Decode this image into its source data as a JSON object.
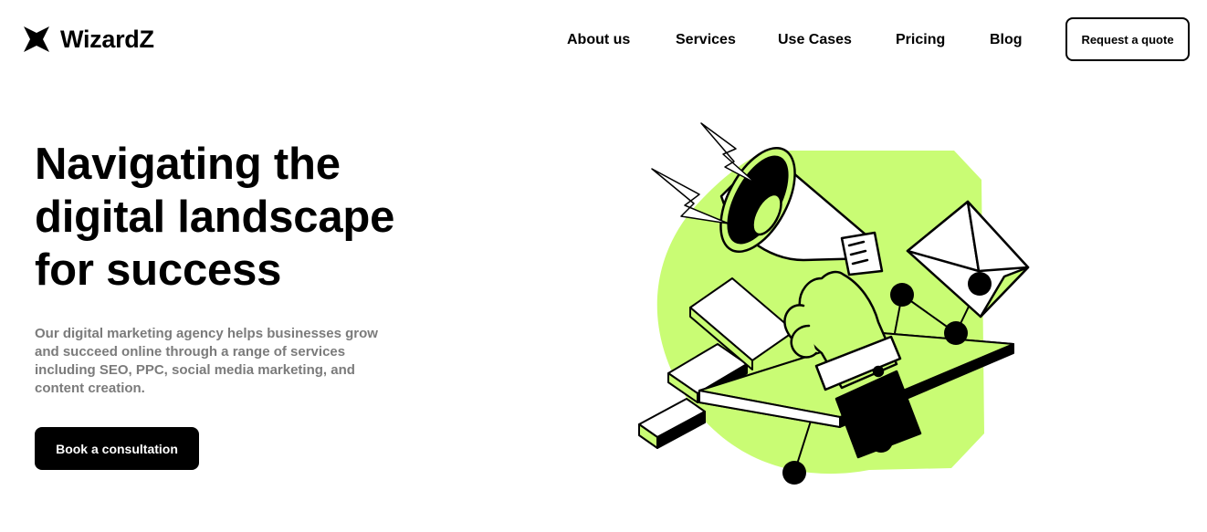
{
  "header": {
    "logo_text": "WizardZ",
    "logo_icon": "star-icon",
    "nav": [
      {
        "label": "About us"
      },
      {
        "label": "Services"
      },
      {
        "label": "Use Cases"
      },
      {
        "label": "Pricing"
      },
      {
        "label": "Blog"
      }
    ],
    "cta_label": "Request a quote"
  },
  "hero": {
    "title_lines": [
      "Navigating the",
      "digital landscape",
      "for success"
    ],
    "description_lines": [
      "Our digital marketing agency helps businesses grow",
      "and succeed online through a range of services",
      "including SEO, PPC, social media marketing, and",
      "content creation."
    ],
    "button_label": "Book a consultation",
    "illustration": "megaphone-illustration"
  },
  "colors": {
    "accent": "#C9FC74",
    "text": "#000000",
    "muted_text": "#7B7B7B",
    "background": "#FFFFFF"
  }
}
